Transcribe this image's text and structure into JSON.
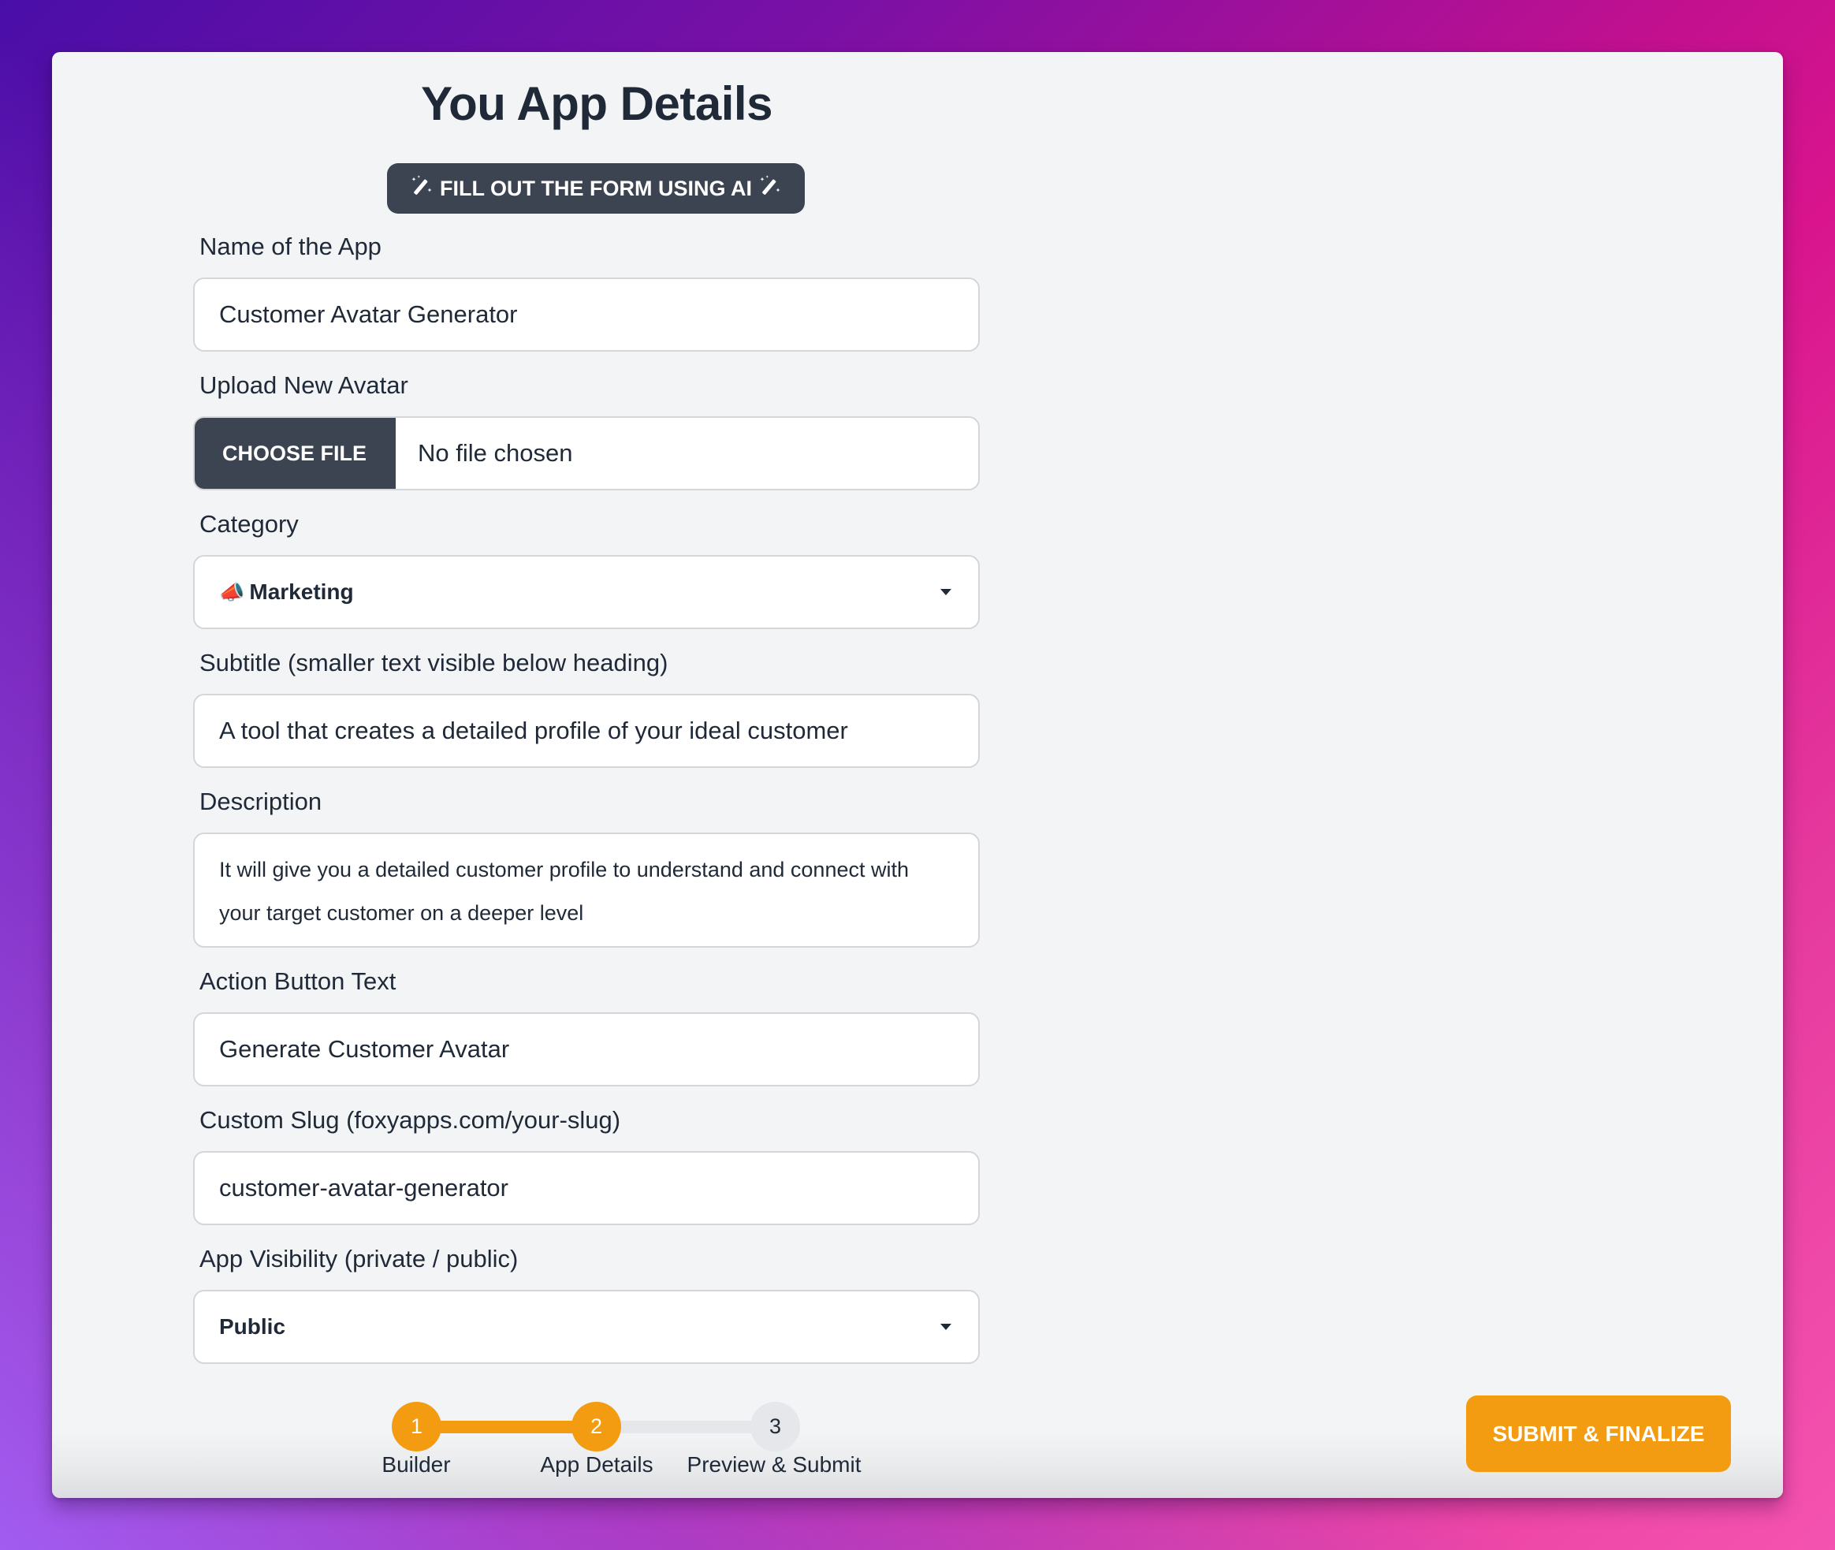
{
  "page": {
    "title": "You App Details",
    "ai_button_label": "FILL OUT THE FORM USING AI",
    "ai_icon": "magic-wand-sparkles-icon"
  },
  "form": {
    "name": {
      "label": "Name of the App",
      "value": "Customer Avatar Generator"
    },
    "avatar": {
      "label": "Upload New Avatar",
      "button_label": "CHOOSE FILE",
      "status": "No file chosen"
    },
    "category": {
      "label": "Category",
      "emoji": "📣",
      "value": "Marketing"
    },
    "subtitle": {
      "label": "Subtitle (smaller text visible below heading)",
      "value": "A tool that creates a detailed profile of your ideal customer"
    },
    "description": {
      "label": "Description",
      "value": "It will give you a detailed customer profile to understand and connect with your target customer on a deeper level"
    },
    "action_button_text": {
      "label": "Action Button Text",
      "value": "Generate Customer Avatar"
    },
    "slug": {
      "label": "Custom Slug (foxyapps.com/your-slug)",
      "value": "customer-avatar-generator"
    },
    "visibility": {
      "label": "App Visibility (private / public)",
      "value": "Public"
    }
  },
  "stepper": {
    "current_step": 2,
    "steps": [
      {
        "number": "1",
        "label": "Builder",
        "state": "complete"
      },
      {
        "number": "2",
        "label": "App Details",
        "state": "active"
      },
      {
        "number": "3",
        "label": "Preview & Submit",
        "state": "upcoming"
      }
    ]
  },
  "footer": {
    "submit_label": "SUBMIT & FINALIZE"
  },
  "colors": {
    "accent": "#f39c12",
    "dark_button": "#3d4451",
    "text": "#1f2937",
    "card_bg": "#f3f4f6",
    "inactive_step": "#e5e7eb"
  }
}
